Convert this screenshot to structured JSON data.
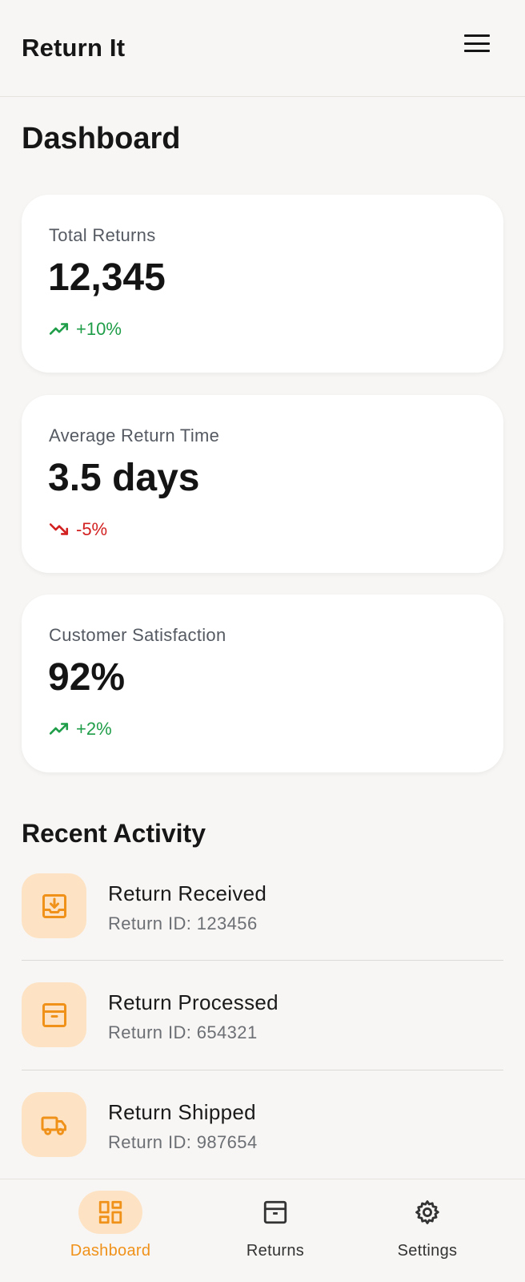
{
  "header": {
    "title": "Return It",
    "menu_icon": "menu-icon"
  },
  "page": {
    "title": "Dashboard"
  },
  "stats": [
    {
      "label": "Total Returns",
      "value": "12,345",
      "trend": "+10%",
      "direction": "up"
    },
    {
      "label": "Average Return Time",
      "value": "3.5 days",
      "trend": "-5%",
      "direction": "down"
    },
    {
      "label": "Customer Satisfaction",
      "value": "92%",
      "trend": "+2%",
      "direction": "up"
    }
  ],
  "recent": {
    "title": "Recent Activity",
    "items": [
      {
        "title": "Return Received",
        "sub": "Return ID: 123456",
        "icon": "inbox-download-icon"
      },
      {
        "title": "Return Processed",
        "sub": "Return ID: 654321",
        "icon": "archive-box-icon"
      },
      {
        "title": "Return Shipped",
        "sub": "Return ID: 987654",
        "icon": "truck-icon"
      }
    ]
  },
  "nav": {
    "items": [
      {
        "label": "Dashboard",
        "icon": "dashboard-icon",
        "active": true
      },
      {
        "label": "Returns",
        "icon": "archive-box-icon",
        "active": false
      },
      {
        "label": "Settings",
        "icon": "gear-icon",
        "active": false
      }
    ]
  },
  "colors": {
    "accent": "#f0921a",
    "accent_soft": "#fde3c4",
    "trend_up": "#1f9d48",
    "trend_down": "#d21f1f",
    "background": "#f7f6f4",
    "card": "#ffffff"
  }
}
